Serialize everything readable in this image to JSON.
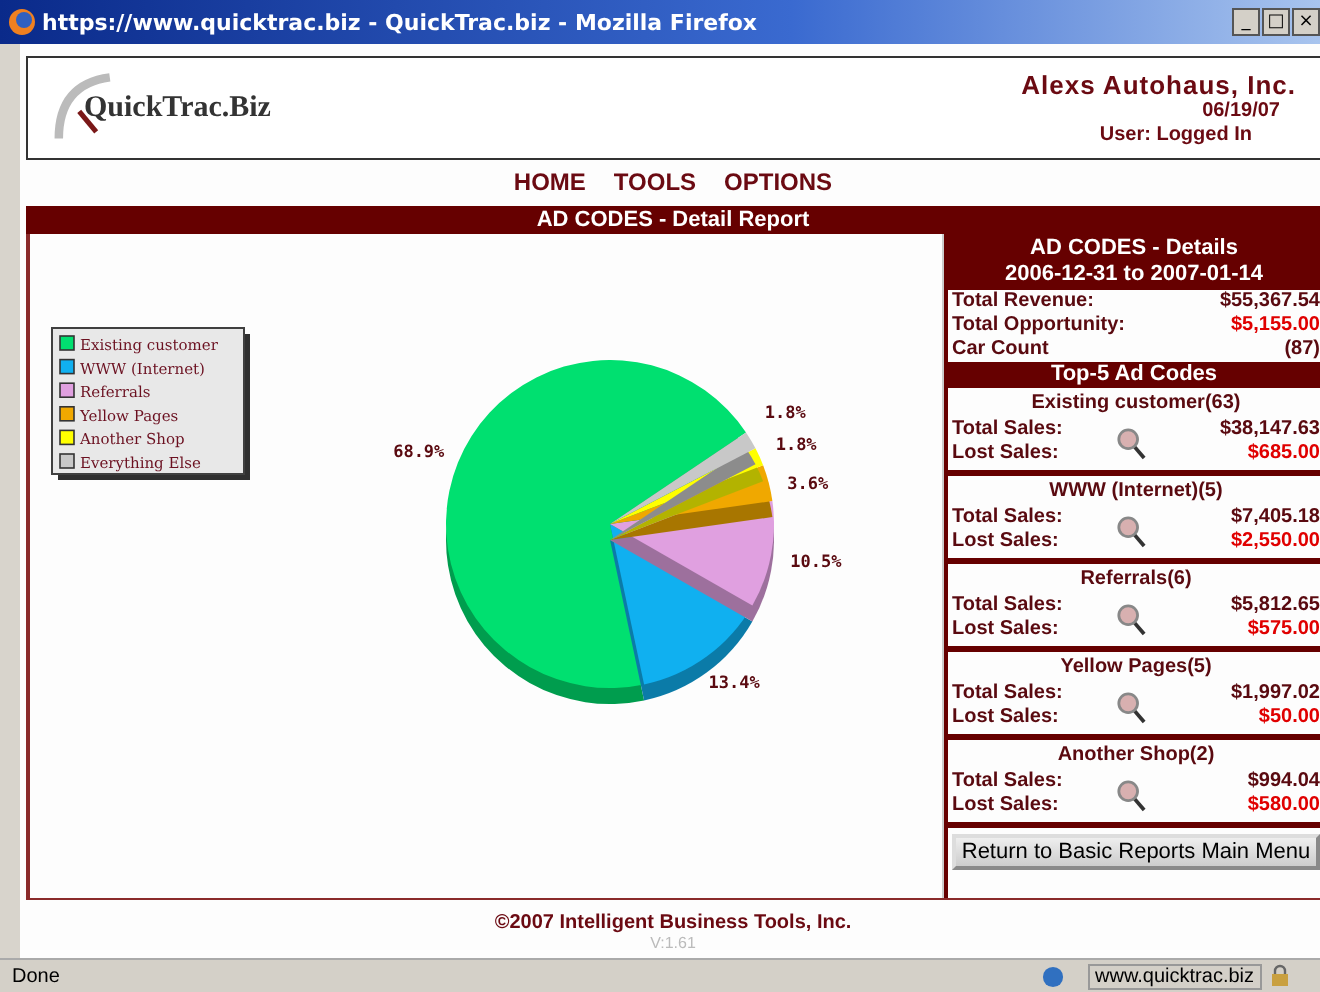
{
  "window": {
    "title": "https://www.quicktrac.biz - QuickTrac.biz - Mozilla Firefox",
    "controls": [
      "_",
      "□",
      "×"
    ]
  },
  "header": {
    "logo": "QuickTrac.Biz",
    "company": "Alexs Autohaus, Inc.",
    "date": "06/19/07",
    "user": "User: Logged In"
  },
  "nav": [
    "HOME",
    "TOOLS",
    "OPTIONS"
  ],
  "report_title": "AD CODES - Detail Report",
  "chart_data": {
    "type": "pie",
    "legend": "upper left",
    "categories": [
      "Existing customer",
      "WWW (Internet)",
      "Referrals",
      "Yellow Pages",
      "Another Shop",
      "Everything Else"
    ],
    "values": [
      68.9,
      13.4,
      10.5,
      3.6,
      1.8,
      1.8
    ],
    "colors": [
      "#00e070",
      "#10b0f0",
      "#e0a0e0",
      "#f0a800",
      "#ffff00",
      "#c8c8c8"
    ],
    "value_labels": [
      "68.9%",
      "13.4%",
      "10.5%",
      "3.6%",
      "1.8%",
      "1.8%"
    ]
  },
  "summary": {
    "title": "AD CODES - Details",
    "range": "2006-12-31 to 2007-01-14",
    "metrics": [
      {
        "label": "Total Revenue:",
        "value": "$55,367.54",
        "kind": "normal"
      },
      {
        "label": "Total Opportunity:",
        "value": "$5,155.00",
        "kind": "loss"
      },
      {
        "label": "Car Count",
        "value": "(87)",
        "kind": "normal"
      }
    ]
  },
  "top_codes": {
    "title": "Top-5 Ad Codes",
    "codes": [
      {
        "name": "Existing customer(63)",
        "total_label": "Total Sales:",
        "total": "$38,147.63",
        "lost_label": "Lost Sales:",
        "lost": "$685.00"
      },
      {
        "name": "WWW (Internet)(5)",
        "total_label": "Total Sales:",
        "total": "$7,405.18",
        "lost_label": "Lost Sales:",
        "lost": "$2,550.00"
      },
      {
        "name": "Referrals(6)",
        "total_label": "Total Sales:",
        "total": "$5,812.65",
        "lost_label": "Lost Sales:",
        "lost": "$575.00"
      },
      {
        "name": "Yellow Pages(5)",
        "total_label": "Total Sales:",
        "total": "$1,997.02",
        "lost_label": "Lost Sales:",
        "lost": "$50.00"
      },
      {
        "name": "Another Shop(2)",
        "total_label": "Total Sales:",
        "total": "$994.04",
        "lost_label": "Lost Sales:",
        "lost": "$580.00"
      }
    ]
  },
  "return_button": "Return to Basic Reports Main Menu",
  "footer": {
    "copyright": "©2007 Intelligent Business Tools, Inc.",
    "version": "V:1.61"
  },
  "status_bar": {
    "status": "Done",
    "url": "www.quicktrac.biz"
  }
}
